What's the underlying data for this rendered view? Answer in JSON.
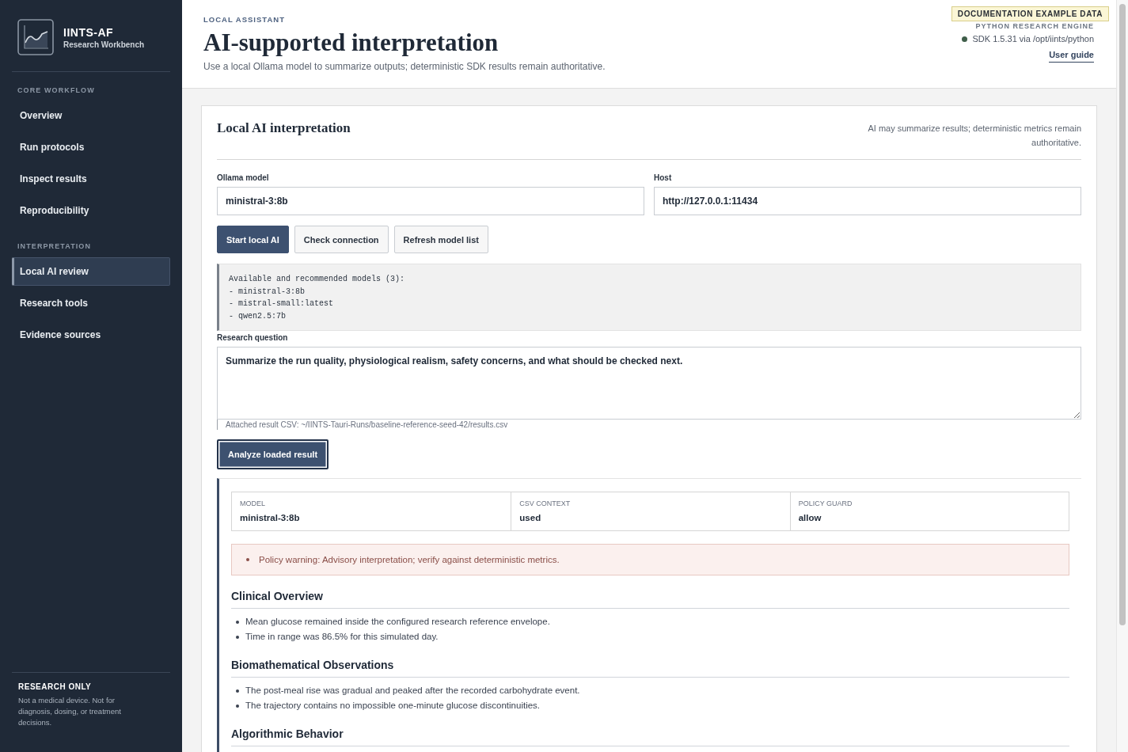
{
  "sidebar": {
    "brand": {
      "title": "IINTS-AF",
      "subtitle": "Research Workbench"
    },
    "sections": [
      {
        "heading": "CORE WORKFLOW",
        "items": [
          {
            "label": "Overview",
            "selected": false
          },
          {
            "label": "Run protocols",
            "selected": false
          },
          {
            "label": "Inspect results",
            "selected": false
          },
          {
            "label": "Reproducibility",
            "selected": false
          }
        ]
      },
      {
        "heading": "INTERPRETATION",
        "items": [
          {
            "label": "Local AI review",
            "selected": true
          },
          {
            "label": "Research tools",
            "selected": false
          },
          {
            "label": "Evidence sources",
            "selected": false
          }
        ]
      }
    ],
    "footer": {
      "title": "RESEARCH ONLY",
      "text": "Not a medical device. Not for diagnosis, dosing, or treatment decisions."
    }
  },
  "header": {
    "eyebrow": "LOCAL ASSISTANT",
    "title": "AI-supported interpretation",
    "subtitle": "Use a local Ollama model to summarize outputs; deterministic SDK results remain authoritative.",
    "badge": "DOCUMENTATION EXAMPLE DATA",
    "engine": {
      "label": "PYTHON RESEARCH ENGINE",
      "status": "SDK 1.5.31 via /opt/iints/python",
      "connected": true
    },
    "link": "User guide"
  },
  "card": {
    "title": "Local AI interpretation",
    "note": "AI may summarize results; deterministic metrics remain authoritative.",
    "fields": [
      {
        "label": "Ollama model",
        "value": "ministral-3:8b"
      },
      {
        "label": "Host",
        "value": "http://127.0.0.1:11434"
      }
    ],
    "buttons": [
      {
        "label": "Start local AI",
        "kind": "primary"
      },
      {
        "label": "Check connection",
        "kind": "secondary"
      },
      {
        "label": "Refresh model list",
        "kind": "secondary"
      }
    ],
    "model_output": "Available and recommended models (3):\n- ministral-3:8b\n- mistral-small:latest\n- qwen2.5:7b",
    "question": {
      "label": "Research question",
      "value": "Summarize the run quality, physiological realism, safety concerns, and what should be checked next."
    },
    "attachment": "Attached result CSV: ~/IINTS-Tauri-Runs/baseline-reference-seed-42/results.csv",
    "analyze_button": {
      "label": "Analyze loaded result",
      "focused": true
    },
    "result": {
      "meta": [
        {
          "label": "MODEL",
          "value": "ministral-3:8b"
        },
        {
          "label": "CSV CONTEXT",
          "value": "used"
        },
        {
          "label": "POLICY GUARD",
          "value": "allow"
        }
      ],
      "warnings": [
        "Policy warning: Advisory interpretation; verify against deterministic metrics."
      ],
      "sections": [
        {
          "heading": "Clinical Overview",
          "bullets": [
            "Mean glucose remained inside the configured research reference envelope.",
            "Time in range was 86.5% for this simulated day."
          ]
        },
        {
          "heading": "Biomathematical Observations",
          "bullets": [
            "The post-meal rise was gradual and peaked after the recorded carbohydrate event.",
            "The trajectory contains no impossible one-minute glucose discontinuities."
          ]
        },
        {
          "heading": "Algorithmic Behavior"
        }
      ]
    }
  }
}
